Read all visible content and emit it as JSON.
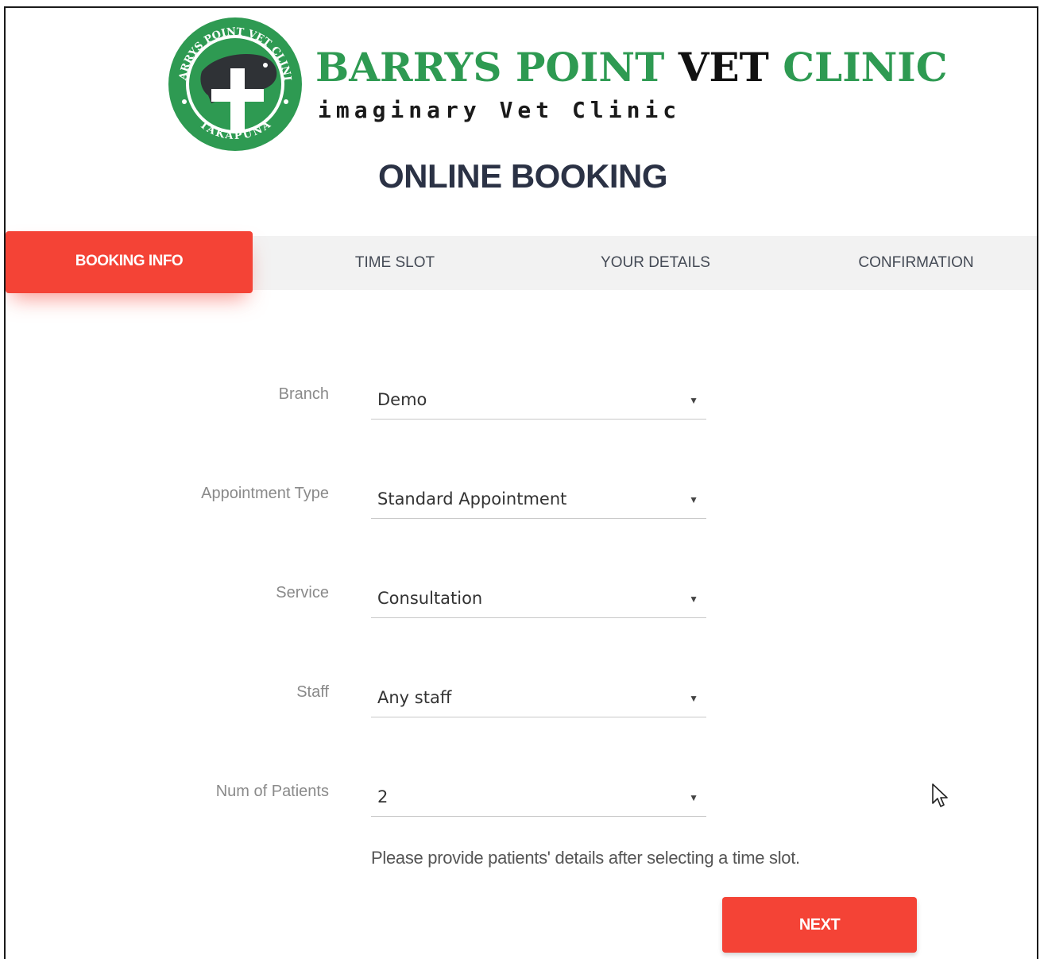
{
  "header": {
    "logo_ring_top": "BARRYS POINT VET CLINIC",
    "logo_ring_bottom": "TAKAPUNA",
    "brand_part1": "BARRYS POINT",
    "brand_part2": "VET",
    "brand_part3": "CLINIC",
    "tagline": "imaginary Vet Clinic",
    "page_title": "ONLINE BOOKING"
  },
  "tabs": [
    {
      "label": "BOOKING INFO",
      "active": true
    },
    {
      "label": "TIME SLOT",
      "active": false
    },
    {
      "label": "YOUR DETAILS",
      "active": false
    },
    {
      "label": "CONFIRMATION",
      "active": false
    }
  ],
  "form": {
    "fields": [
      {
        "label": "Branch",
        "value": "Demo"
      },
      {
        "label": "Appointment Type",
        "value": "Standard Appointment"
      },
      {
        "label": "Service",
        "value": "Consultation"
      },
      {
        "label": "Staff",
        "value": "Any staff"
      },
      {
        "label": "Num of Patients",
        "value": "2"
      }
    ],
    "hint": "Please provide patients' details after selecting a time slot.",
    "next_label": "NEXT"
  },
  "colors": {
    "accent": "#f44336",
    "brand_green": "#2e9a52",
    "title": "#2b3245"
  },
  "icons": [
    "dropdown-caret-icon",
    "mouse-pointer-icon"
  ]
}
